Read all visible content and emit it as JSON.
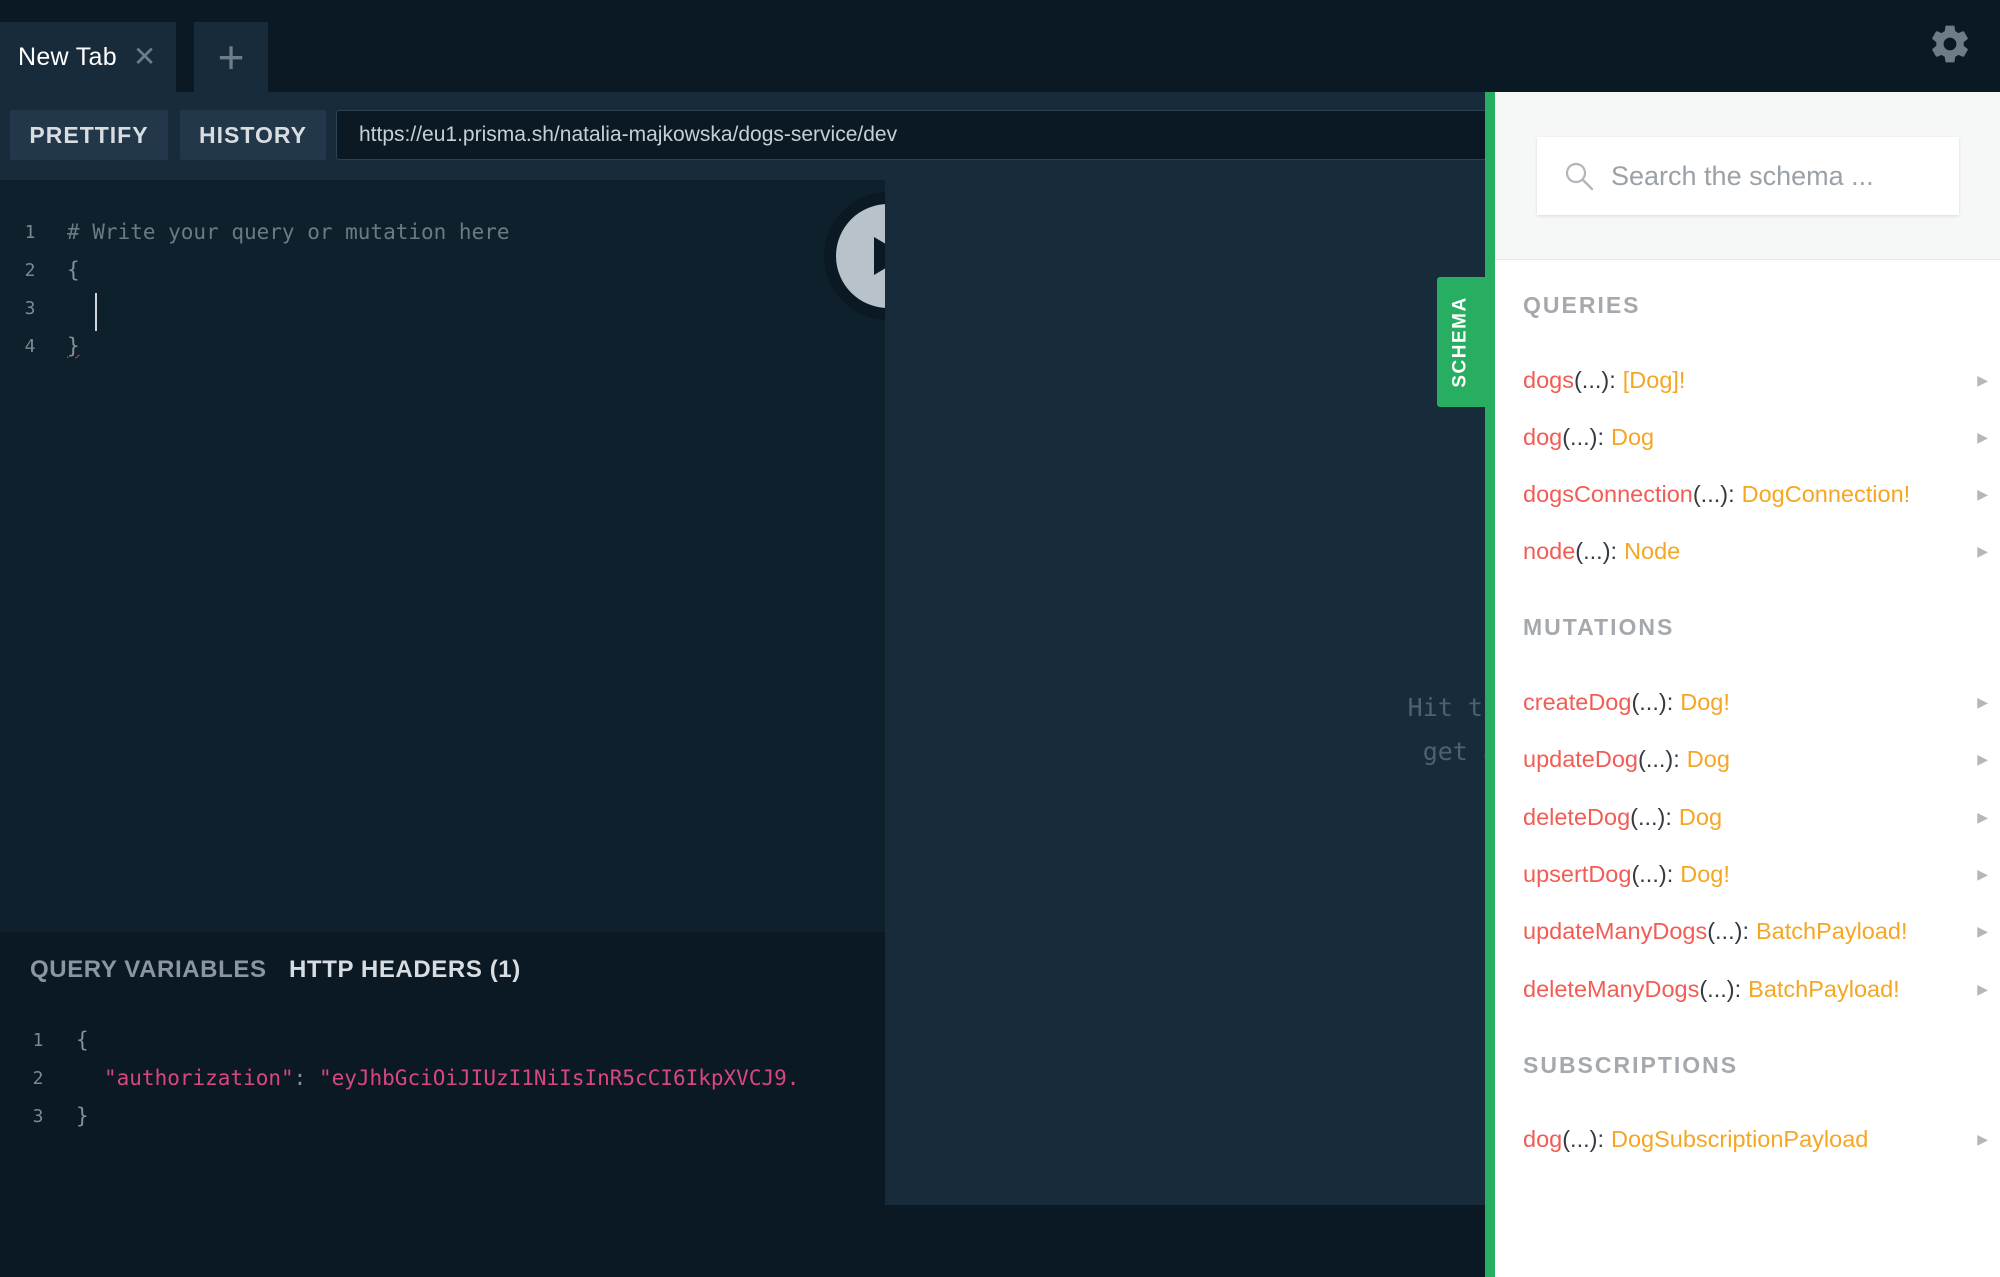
{
  "tabs": {
    "active": {
      "title": "New Tab",
      "close": "✕"
    },
    "add": "+"
  },
  "toolbar": {
    "prettify": "PRETTIFY",
    "history": "HISTORY",
    "endpoint": "https://eu1.prisma.sh/natalia-majkowska/dogs-service/dev"
  },
  "editor": {
    "lines": [
      {
        "n": "1",
        "text": "# Write your query or mutation here"
      },
      {
        "n": "2",
        "text": "{"
      },
      {
        "n": "3",
        "text": ""
      },
      {
        "n": "4",
        "text": "}"
      }
    ]
  },
  "variables": {
    "tab_query_variables": "QUERY VARIABLES",
    "tab_http_headers": "HTTP HEADERS (1)",
    "lines": [
      {
        "n": "1",
        "text": "{"
      },
      {
        "n": "2",
        "key": "\"authorization\"",
        "sep": ": ",
        "value": "\"eyJhbGciOiJIUzI1NiIsInR5cCI6IkpXVCJ9."
      },
      {
        "n": "3",
        "text": "}"
      }
    ]
  },
  "result": {
    "hint_line1": "Hit the Play B",
    "hint_line2": "get a respon"
  },
  "schema": {
    "tab_label": "SCHEMA",
    "search_placeholder": "Search the schema ...",
    "queries_title": "QUERIES",
    "queries": [
      {
        "name": "dogs",
        "args": "(...)",
        "type": "[Dog]!"
      },
      {
        "name": "dog",
        "args": "(...)",
        "type": "Dog"
      },
      {
        "name": "dogsConnection",
        "args": "(...)",
        "type": "DogConnection!"
      },
      {
        "name": "node",
        "args": "(...)",
        "type": "Node"
      }
    ],
    "mutations_title": "MUTATIONS",
    "mutations": [
      {
        "name": "createDog",
        "args": "(...)",
        "type": "Dog!"
      },
      {
        "name": "updateDog",
        "args": "(...)",
        "type": "Dog"
      },
      {
        "name": "deleteDog",
        "args": "(...)",
        "type": "Dog"
      },
      {
        "name": "upsertDog",
        "args": "(...)",
        "type": "Dog!"
      },
      {
        "name": "updateManyDogs",
        "args": "(...)",
        "type": "BatchPayload!"
      },
      {
        "name": "deleteManyDogs",
        "args": "(...)",
        "type": "BatchPayload!"
      }
    ],
    "subscriptions_title": "SUBSCRIPTIONS",
    "subscriptions": [
      {
        "name": "dog",
        "args": "(...)",
        "type": "DogSubscriptionPayload"
      }
    ],
    "separator": ":",
    "expand_arrow": "▶"
  },
  "colors": {
    "accent_green": "#27ae60",
    "field_name": "#f25c54",
    "field_type": "#f5a623",
    "string_pink": "#d9477f"
  },
  "icons": {
    "tab_close": "close-icon",
    "tab_add": "plus-icon",
    "settings": "gear-icon",
    "play": "play-icon",
    "search": "search-icon",
    "expand": "triangle-right-icon"
  }
}
